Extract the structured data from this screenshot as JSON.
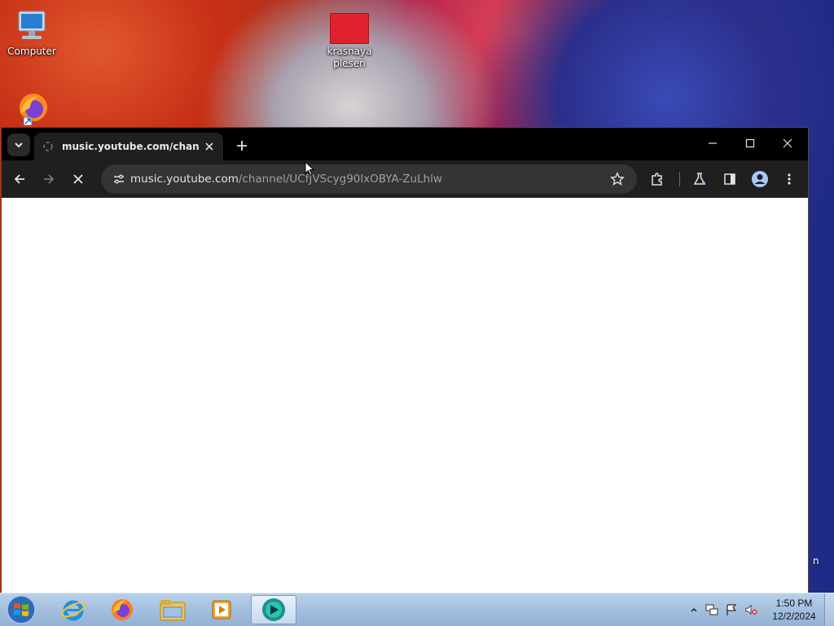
{
  "desktop": {
    "icons": [
      {
        "label": "Computer",
        "icon": "computer-icon"
      },
      {
        "label": "krasnaya\nplesen",
        "line1": "krasnaya",
        "line2": "plesen",
        "icon": "folder-red-icon"
      },
      {
        "label": "",
        "icon": "firefox-shortcut-icon"
      }
    ],
    "edge_text": "n"
  },
  "browser": {
    "tab": {
      "title": "music.youtube.com/channel/U",
      "favicon": "loading-favicon-icon"
    },
    "new_tab_icon": "plus-icon",
    "window_controls": [
      "minimize-icon",
      "maximize-icon",
      "close-icon"
    ],
    "toolbar": {
      "url_host": "music.youtube.com",
      "url_path": "/channel/UCfJVScyg90lxOBYA-ZuLhlw",
      "back_icon": "arrow-left-icon",
      "forward_icon": "arrow-right-icon",
      "stop_icon": "x-icon",
      "site_info_icon": "tune-icon",
      "bookmark_icon": "star-icon",
      "extensions_icon": "puzzle-icon",
      "labs_icon": "flask-icon",
      "side_panel_icon": "side-panel-icon",
      "profile_icon": "avatar-icon",
      "menu_icon": "kebab-menu-icon"
    },
    "colors": {
      "frame": "#000000",
      "toolbar": "#1f1f1f",
      "omnibox": "#343434"
    }
  },
  "taskbar": {
    "apps": [
      "internet-explorer-icon",
      "firefox-icon",
      "file-explorer-icon",
      "media-player-icon",
      "chrome-app-icon"
    ],
    "clock": {
      "time": "1:50 PM",
      "date": "12/2/2024"
    },
    "tray_icons": [
      "chevron-up-icon",
      "network-icon",
      "flag-icon",
      "volume-muted-icon"
    ]
  }
}
